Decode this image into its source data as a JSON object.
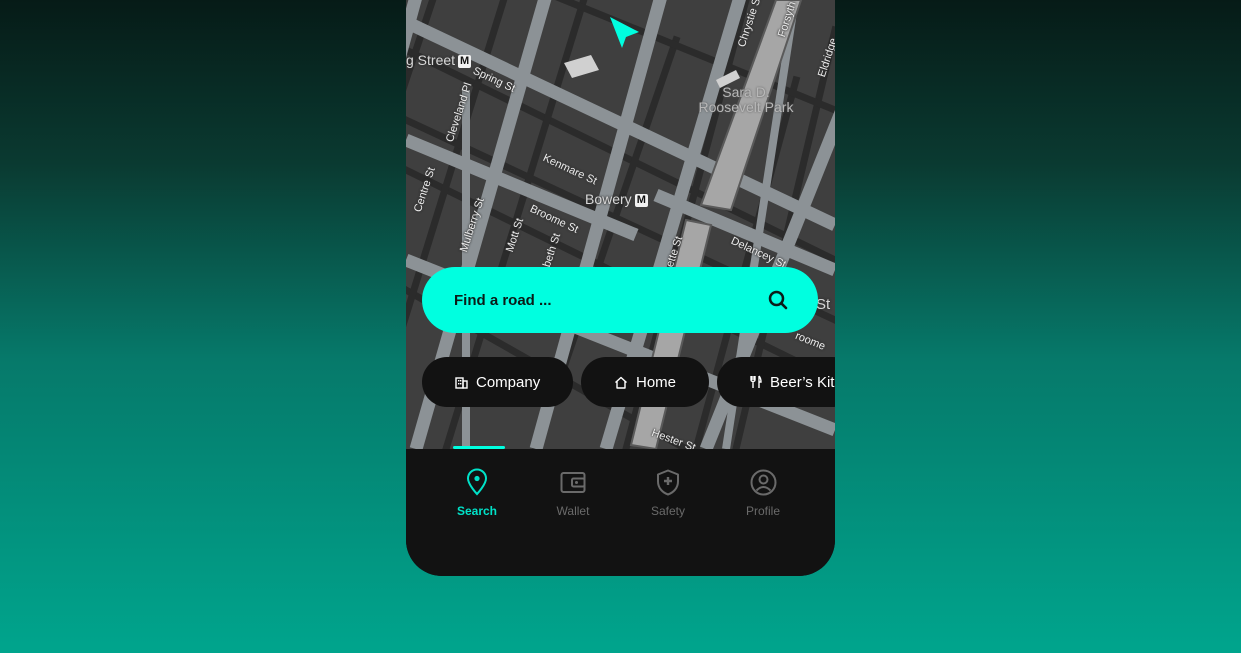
{
  "map": {
    "labels": {
      "street_station": "g Street",
      "bowery": "Bowery",
      "metro_badge": "M",
      "park_line1": "Sara D.",
      "park_line2": "Roosevelt Park",
      "spring_st": "Spring St",
      "kenmare_st": "Kenmare St",
      "broome_st": "Broome St",
      "delancey_st": "Delancey St",
      "mulberry_st": "Mulberry St",
      "mott_st": "Mott St",
      "centre_st": "Centre St",
      "cleveland_pl": "Cleveland Pl",
      "hester_st": "Hester St",
      "forsyth_st": "Forsyth St",
      "chrystie_st": "Chrystie St",
      "eldridge_st": "Eldridge",
      "elizabeth_st": "beth St",
      "lafayette_st": "ette St",
      "st_right": "St",
      "broome_right": "roome"
    },
    "colors": {
      "background": "#3f3f3f",
      "road": "#8c9296",
      "alley": "#2b2b2b",
      "navigation_arrow": "#00ffe0"
    }
  },
  "search": {
    "placeholder": "Find a road ...",
    "icon": "search-icon"
  },
  "chips": [
    {
      "label": "Company",
      "icon": "building-icon"
    },
    {
      "label": "Home",
      "icon": "home-icon"
    },
    {
      "label": "Beer’s Kit",
      "icon": "restaurant-icon"
    }
  ],
  "bottom_nav": {
    "items": [
      {
        "label": "Search",
        "icon": "location-pin-icon",
        "active": true
      },
      {
        "label": "Wallet",
        "icon": "wallet-icon",
        "active": false
      },
      {
        "label": "Safety",
        "icon": "shield-icon",
        "active": false
      },
      {
        "label": "Profile",
        "icon": "profile-icon",
        "active": false
      }
    ]
  },
  "colors": {
    "accent": "#00ffe0",
    "surface": "#121212",
    "inactive": "#6a6a6a"
  }
}
